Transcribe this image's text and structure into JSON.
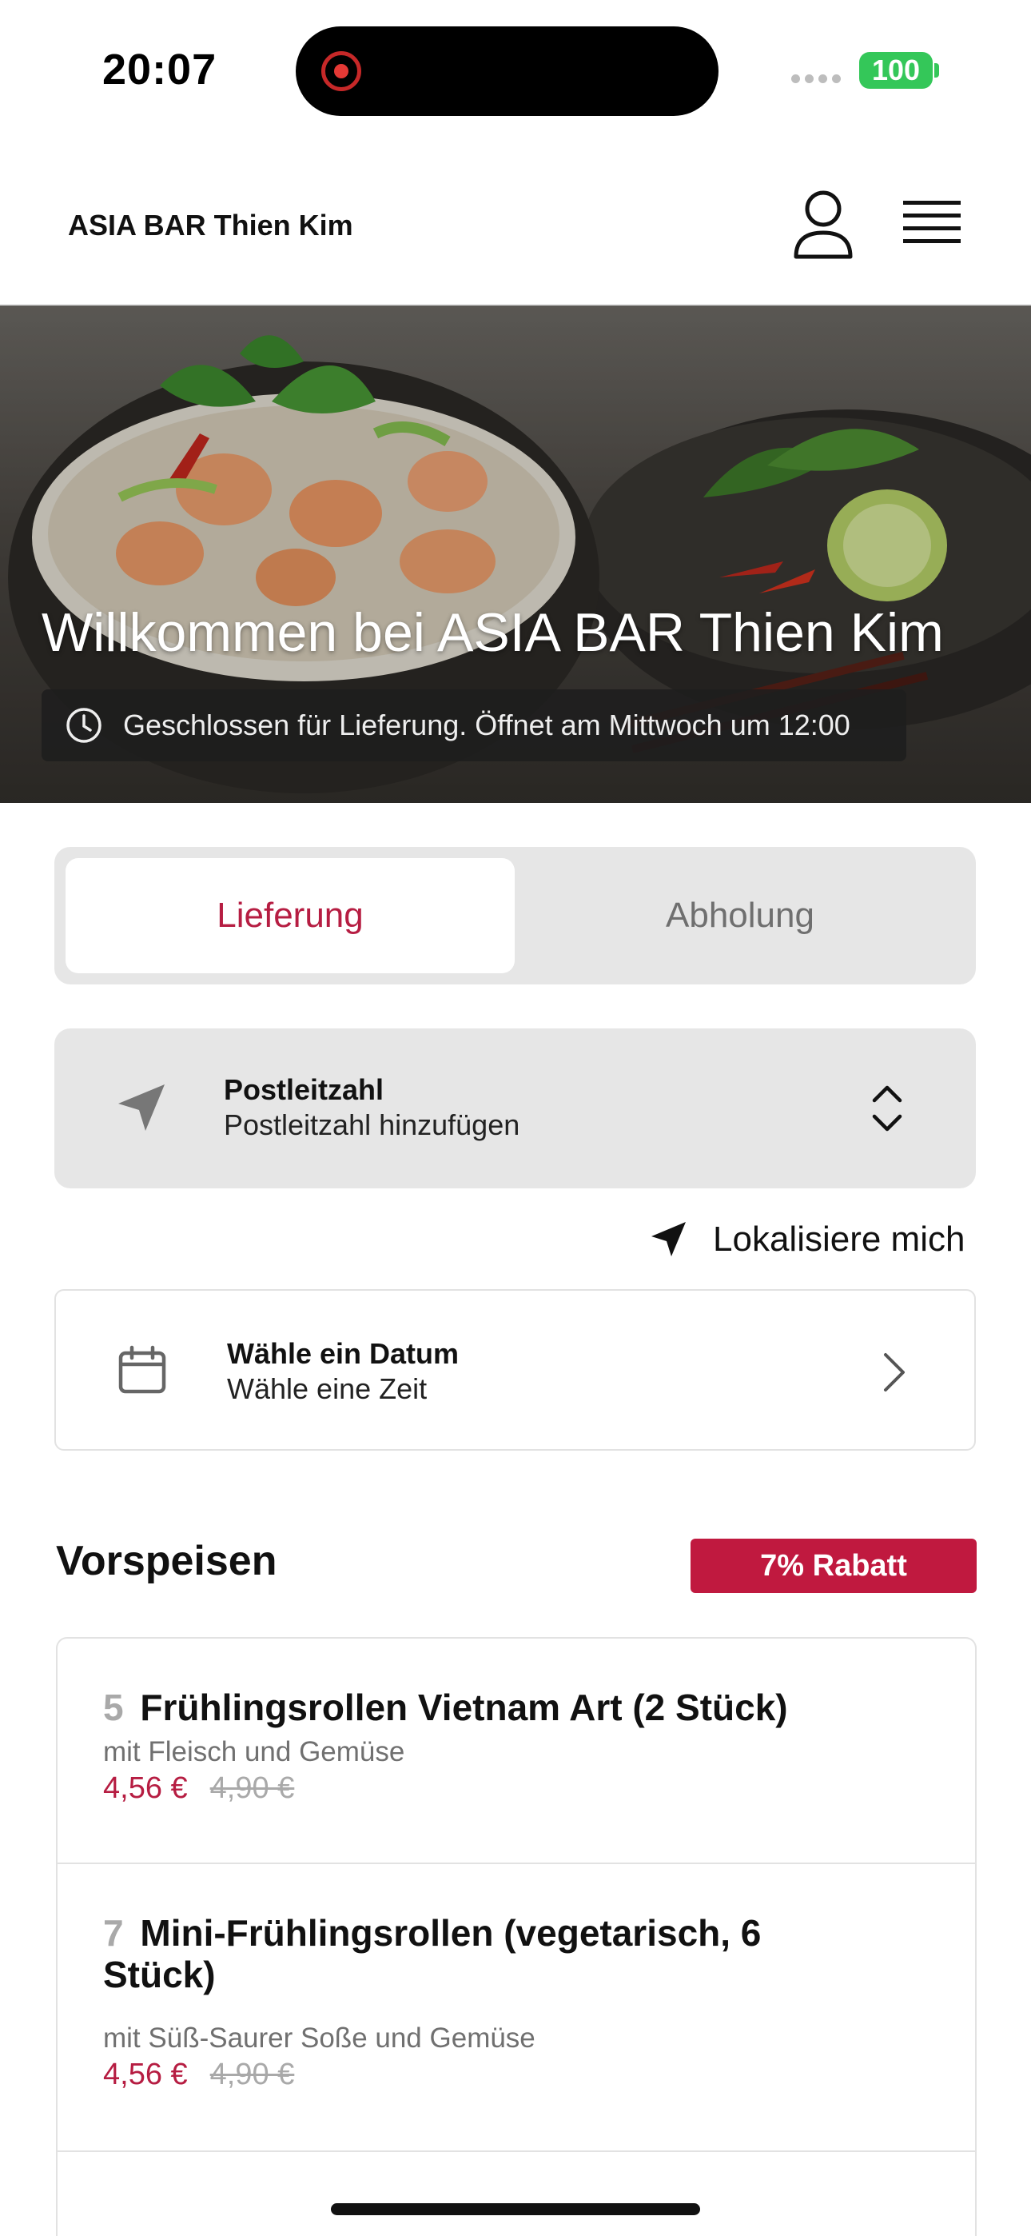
{
  "status_bar": {
    "time": "20:07",
    "battery": "100"
  },
  "header": {
    "brand": "ASIA BAR Thien Kim"
  },
  "hero": {
    "title": "Willkommen bei ASIA BAR Thien Kim",
    "status": "Geschlossen für Lieferung. Öffnet am Mittwoch um 12:00"
  },
  "mode": {
    "delivery": "Lieferung",
    "pickup": "Abholung",
    "selected": "Lieferung"
  },
  "postcode": {
    "label": "Postleitzahl",
    "placeholder": "Postleitzahl hinzufügen"
  },
  "locate": {
    "label": "Lokalisiere mich"
  },
  "date": {
    "title": "Wähle ein Datum",
    "subtitle": "Wähle eine Zeit"
  },
  "section": {
    "title": "Vorspeisen",
    "badge": "7% Rabatt"
  },
  "items": [
    {
      "number": "5",
      "name": "Frühlingsrollen Vietnam Art (2 Stück)",
      "description": "mit Fleisch und Gemüse",
      "price": "4,56 €",
      "old_price": "4,90 €"
    },
    {
      "number": "7",
      "name": "Mini-Frühlingsrollen (vegetarisch, 6 Stück)",
      "description": "mit Süß-Saurer Soße und Gemüse",
      "price": "4,56 €",
      "old_price": "4,90 €"
    }
  ],
  "colors": {
    "accent": "#b61d42",
    "badge": "#c0193f",
    "panel": "#e6e6e6",
    "battery": "#34c759"
  }
}
